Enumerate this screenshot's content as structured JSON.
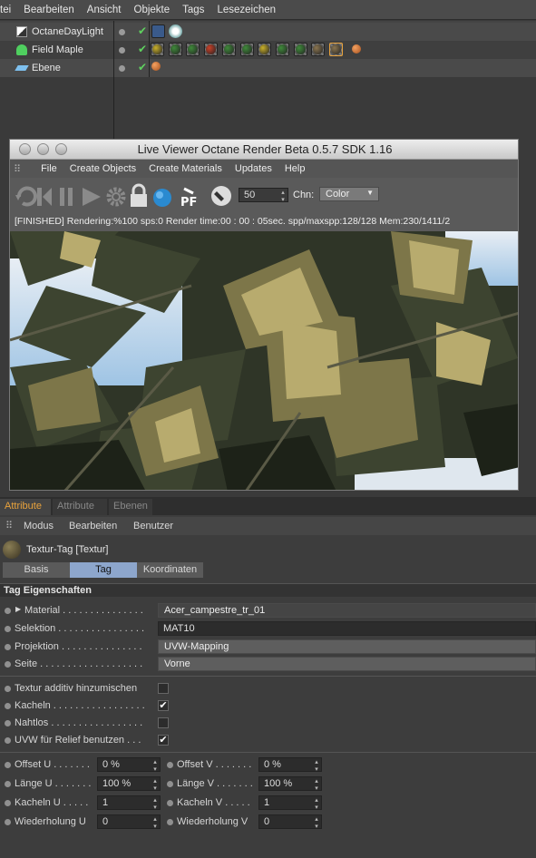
{
  "menubar": [
    "tei",
    "Bearbeiten",
    "Ansicht",
    "Objekte",
    "Tags",
    "Lesezeichen"
  ],
  "objects": [
    {
      "name": "OctaneDayLight"
    },
    {
      "name": "Field Maple"
    },
    {
      "name": "Ebene"
    }
  ],
  "live_viewer": {
    "title": "Live Viewer    Octane Render Beta 0.5.7    SDK 1.16",
    "menu": [
      "File",
      "Create Objects",
      "Create Materials",
      "Updates",
      "Help"
    ],
    "value_50": "50",
    "chn_label": "Chn:",
    "chn_value": "Color",
    "status": "[FINISHED]  Rendering:%100 sps:0 Render time:00 : 00 : 05sec. spp/maxspp:128/128 Mem:230/1411/2"
  },
  "attr": {
    "tabs": [
      "Attribute",
      "Attribute",
      "Ebenen"
    ],
    "menu": [
      "Modus",
      "Bearbeiten",
      "Benutzer"
    ],
    "object_title": "Textur-Tag [Textur]",
    "subtabs": [
      "Basis",
      "Tag",
      "Koordinaten"
    ],
    "section": "Tag Eigenschaften",
    "material_label": "Material . . . . . . . . . . . . . . .",
    "material_value": "Acer_campestre_tr_01",
    "selektion_label": "Selektion . . . . . . . . . . . . . . . .",
    "selektion_value": "MAT10",
    "projektion_label": "Projektion . . . . . . . . . . . . . . .",
    "projektion_value": "UVW-Mapping",
    "seite_label": "Seite . . . . . . . . . . . . . . . . . . .",
    "seite_value": "Vorne",
    "textur_additiv": "Textur additiv hinzumischen",
    "kacheln": "Kacheln . . . . . . . . . . . . . . . . .",
    "nahtlos": "Nahtlos . . . . . . . . . . . . . . . . .",
    "uvw_relief": "UVW für Relief benutzen . . .",
    "offset_u": "Offset U . . . . . . .",
    "offset_u_val": "0 %",
    "offset_v": "Offset V . . . . . . .",
    "offset_v_val": "0 %",
    "laenge_u": "Länge U . . . . . . .",
    "laenge_u_val": "100 %",
    "laenge_v": "Länge V . . . . . . .",
    "laenge_v_val": "100 %",
    "kacheln_u": "Kacheln U . . . . .",
    "kacheln_u_val": "1",
    "kacheln_v": "Kacheln V . . . . .",
    "kacheln_v_val": "1",
    "wdh_u": "Wiederholung U",
    "wdh_u_val": "0",
    "wdh_v": "Wiederholung V",
    "wdh_v_val": "0"
  },
  "colors": {
    "accent_tab": "#e8a23c",
    "active_subtab": "#8da6cc",
    "check": "#5fd15f"
  }
}
